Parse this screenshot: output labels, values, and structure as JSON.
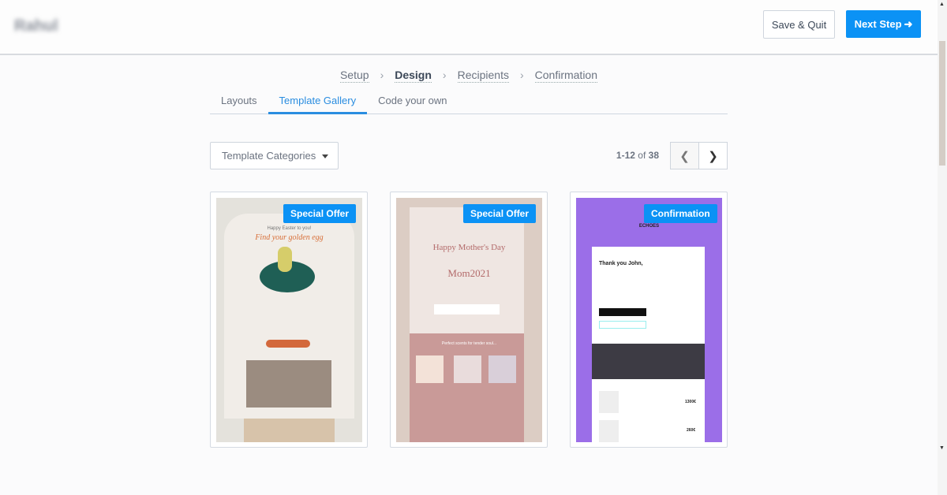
{
  "header": {
    "brand": "Rahul",
    "save_quit": "Save & Quit",
    "next_step": "Next Step",
    "next_icon": "arrow-right-icon"
  },
  "steps": [
    "Setup",
    "Design",
    "Recipients",
    "Confirmation"
  ],
  "active_step": "Design",
  "tabs": [
    "Layouts",
    "Template Gallery",
    "Code your own"
  ],
  "active_tab": "Template Gallery",
  "filter": {
    "label": "Template Categories"
  },
  "pagination": {
    "range": "1-12",
    "of": "of",
    "total": "38"
  },
  "templates": [
    {
      "badge": "Special Offer",
      "headline": "Find your golden egg",
      "sub": "Happy Easter to you!",
      "color": "#e4e2dc"
    },
    {
      "badge": "Special Offer",
      "headline": "Happy Mother's Day",
      "code": "Mom2021",
      "sub": "Perfect scents for tender soul...",
      "color": "#dccdc4"
    },
    {
      "badge": "Confirmation",
      "headline": "Thank you John,",
      "brand": "ECHOES",
      "prices": [
        "1300€",
        "260€"
      ],
      "color": "#9b6ee8"
    }
  ],
  "colors": {
    "accent": "#0b92f5"
  }
}
